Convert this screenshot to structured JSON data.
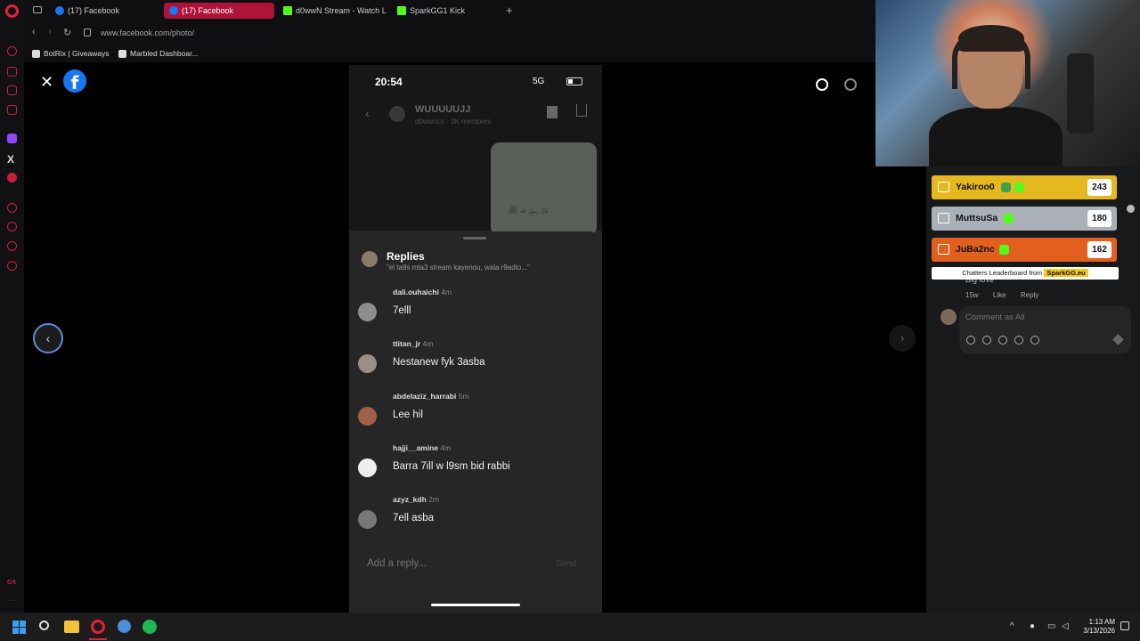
{
  "browser": {
    "tabs": [
      {
        "label": "(17) Facebook",
        "icon": "facebook-icon"
      },
      {
        "label": "(17) Facebook",
        "icon": "facebook-icon"
      },
      {
        "label": "d0wwN Stream - Watch L",
        "icon": "kick-icon"
      },
      {
        "label": "SparkGG1 Kick",
        "icon": "sparkgg-icon"
      }
    ],
    "active_tab_index": 1,
    "url": "www.facebook.com/photo/",
    "bookmarks": [
      {
        "label": "BotRix | Giveaways"
      },
      {
        "label": "Marbled Dashboar..."
      }
    ]
  },
  "phone": {
    "time": "20:54",
    "network": "5G",
    "group_name": "WUUUUUJJ",
    "group_sub": "d0wwncs · 3K members",
    "image_caption": "قال رسول الله ﷺ",
    "replies_title": "Replies",
    "replies_quote": "\"el ta9s mta3 stream kayenou, wala r9adto...\"",
    "comments": [
      {
        "user": "dali.ouhaichi",
        "time": "4m",
        "text": "7elll"
      },
      {
        "user": "ttitan_jr",
        "time": "4m",
        "text": "Nestanew fyk 3asba"
      },
      {
        "user": "abdelaziz_harrabi",
        "time": "5m",
        "text": "Lee hil"
      },
      {
        "user": "hajji__amine",
        "time": "4m",
        "text": "Barra 7ill w l9sm bid rabbi"
      },
      {
        "user": "azyz_kdh",
        "time": "2m",
        "text": "7ell asba"
      }
    ],
    "reply_placeholder": "Add a reply...",
    "send_label": "Send"
  },
  "leaderboard": {
    "rows": [
      {
        "name": "Yakiroo0",
        "score": "243",
        "tier": "gold"
      },
      {
        "name": "MuttsuSa",
        "score": "180",
        "tier": "silver"
      },
      {
        "name": "JuBa2nc",
        "score": "162",
        "tier": "bronze"
      }
    ],
    "footer_prefix": "Chatters Leaderboard from",
    "footer_brand": "SparkGG.eu"
  },
  "fb_panel": {
    "prev_comment_text": "Big love",
    "meta": [
      "15w",
      "Like",
      "Reply"
    ],
    "comment_placeholder": "Comment as Ali"
  },
  "taskbar": {
    "time": "1:13 AM",
    "date": "3/13/2026"
  },
  "colors": {
    "opera_red": "#e0213a",
    "facebook_blue": "#1877f2",
    "active_tab": "#b0133a",
    "gold": "#e6b820",
    "silver": "#a9b0b8",
    "bronze": "#e2601e"
  }
}
